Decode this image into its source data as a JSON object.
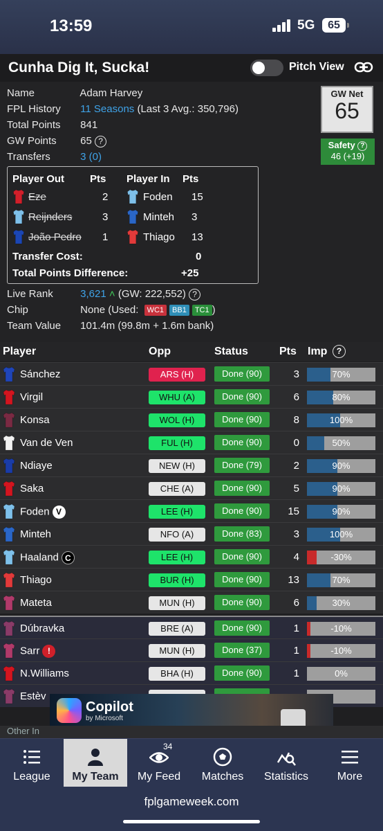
{
  "status_bar": {
    "time": "13:59",
    "network": "5G",
    "battery": "65"
  },
  "header": {
    "team_name": "Cunha Dig It, Sucka!",
    "pitch_view_label": "Pitch View"
  },
  "info": {
    "name_label": "Name",
    "name_value": "Adam Harvey",
    "history_label": "FPL History",
    "history_link": "11 Seasons",
    "history_rest": "(Last 3 Avg.: 350,796)",
    "total_label": "Total Points",
    "total_value": "841",
    "gw_label": "GW Points",
    "gw_value": "65",
    "transfers_label": "Transfers",
    "transfers_value": "3 (0)",
    "live_rank_label": "Live Rank",
    "live_rank_value": "3,621",
    "live_rank_gw": "(GW: 222,552)",
    "chip_label": "Chip",
    "chip_value": "None",
    "chip_used_prefix": "(Used:",
    "chip_used_suffix": ")",
    "chips": [
      {
        "label": "WC1",
        "color": "#c8323c"
      },
      {
        "label": "BB1",
        "color": "#2f8fb8"
      },
      {
        "label": "TC1",
        "color": "#2a8f3a"
      }
    ],
    "team_value_label": "Team Value",
    "team_value": "101.4m (99.8m + 1.6m bank)"
  },
  "gw_net": {
    "title": "GW Net",
    "value": "65"
  },
  "safety": {
    "title": "Safety",
    "value": "46 (+19)"
  },
  "transfers": {
    "headers": {
      "out": "Player Out",
      "pts": "Pts",
      "in": "Player In",
      "pts_in": "Pts"
    },
    "rows": [
      {
        "out": "Eze",
        "out_pts": "2",
        "in": "Foden",
        "in_pts": "15",
        "out_kit": "#d11f2a",
        "in_kit": "#7ec0ea"
      },
      {
        "out": "Reijnders",
        "out_pts": "3",
        "in": "Minteh",
        "in_pts": "3",
        "out_kit": "#7ec0ea",
        "in_kit": "#2a66c7"
      },
      {
        "out": "João Pedro",
        "out_pts": "1",
        "in": "Thiago",
        "in_pts": "13",
        "out_kit": "#1b46b4",
        "in_kit": "#e23a3a"
      }
    ],
    "cost_label": "Transfer Cost:",
    "cost_value": "0",
    "diff_label": "Total Points Difference:",
    "diff_value": "+25"
  },
  "table": {
    "headers": {
      "player": "Player",
      "opp": "Opp",
      "status": "Status",
      "pts": "Pts",
      "imp": "Imp"
    },
    "players": [
      {
        "name": "Sánchez",
        "badge": "",
        "kit": "#1f45b8",
        "opp": "ARS (H)",
        "opp_color": "#e0224e",
        "opp_text": "#ffffff",
        "status": "Done (90)",
        "pts": "3",
        "imp": "70%",
        "imp_pct": 0.34,
        "neg": false,
        "bench": false
      },
      {
        "name": "Virgil",
        "badge": "",
        "kit": "#d3151f",
        "opp": "WHU (A)",
        "opp_color": "#1ee36a",
        "opp_text": "#111111",
        "status": "Done (90)",
        "pts": "6",
        "imp": "80%",
        "imp_pct": 0.38,
        "neg": false,
        "bench": false
      },
      {
        "name": "Konsa",
        "badge": "",
        "kit": "#7a2a43",
        "opp": "WOL (H)",
        "opp_color": "#1ee36a",
        "opp_text": "#111111",
        "status": "Done (90)",
        "pts": "8",
        "imp": "100%",
        "imp_pct": 0.48,
        "neg": false,
        "bench": false
      },
      {
        "name": "Van de Ven",
        "badge": "",
        "kit": "#f2f2f2",
        "opp": "FUL (H)",
        "opp_color": "#1ee36a",
        "opp_text": "#111111",
        "status": "Done (90)",
        "pts": "0",
        "imp": "50%",
        "imp_pct": 0.25,
        "neg": false,
        "bench": false
      },
      {
        "name": "Ndiaye",
        "badge": "",
        "kit": "#1a3ca8",
        "opp": "NEW (H)",
        "opp_color": "#e6e6e6",
        "opp_text": "#111111",
        "status": "Done (79)",
        "pts": "2",
        "imp": "90%",
        "imp_pct": 0.44,
        "neg": false,
        "bench": false
      },
      {
        "name": "Saka",
        "badge": "",
        "kit": "#d3151f",
        "opp": "CHE (A)",
        "opp_color": "#e6e6e6",
        "opp_text": "#111111",
        "status": "Done (90)",
        "pts": "5",
        "imp": "90%",
        "imp_pct": 0.44,
        "neg": false,
        "bench": false
      },
      {
        "name": "Foden",
        "badge": "V",
        "badge_style": "white",
        "kit": "#7ec0ea",
        "opp": "LEE (H)",
        "opp_color": "#1ee36a",
        "opp_text": "#111111",
        "status": "Done (90)",
        "pts": "15",
        "imp": "90%",
        "imp_pct": 0.44,
        "neg": false,
        "bench": false
      },
      {
        "name": "Minteh",
        "badge": "",
        "kit": "#2a66c7",
        "opp": "NFO (A)",
        "opp_color": "#e6e6e6",
        "opp_text": "#111111",
        "status": "Done (83)",
        "pts": "3",
        "imp": "100%",
        "imp_pct": 0.48,
        "neg": false,
        "bench": false
      },
      {
        "name": "Haaland",
        "badge": "C",
        "badge_style": "dark",
        "kit": "#7ec0ea",
        "opp": "LEE (H)",
        "opp_color": "#1ee36a",
        "opp_text": "#111111",
        "status": "Done (90)",
        "pts": "4",
        "imp": "-30%",
        "imp_pct": 0.14,
        "neg": true,
        "bench": false
      },
      {
        "name": "Thiago",
        "badge": "",
        "kit": "#e23a3a",
        "opp": "BUR (H)",
        "opp_color": "#1ee36a",
        "opp_text": "#111111",
        "status": "Done (90)",
        "pts": "13",
        "imp": "70%",
        "imp_pct": 0.34,
        "neg": false,
        "bench": false
      },
      {
        "name": "Mateta",
        "badge": "",
        "kit": "#b03a6a",
        "opp": "MUN (H)",
        "opp_color": "#e6e6e6",
        "opp_text": "#111111",
        "status": "Done (90)",
        "pts": "6",
        "imp": "30%",
        "imp_pct": 0.14,
        "neg": false,
        "bench": false
      },
      {
        "name": "Dúbravka",
        "badge": "",
        "kit": "#8a3b68",
        "opp": "BRE (A)",
        "opp_color": "#e6e6e6",
        "opp_text": "#111111",
        "status": "Done (90)",
        "pts": "1",
        "imp": "-10%",
        "imp_pct": 0.05,
        "neg": true,
        "bench": true
      },
      {
        "name": "Sarr",
        "badge": "!",
        "badge_style": "red",
        "kit": "#b03a6a",
        "opp": "MUN (H)",
        "opp_color": "#e6e6e6",
        "opp_text": "#111111",
        "status": "Done (37)",
        "pts": "1",
        "imp": "-10%",
        "imp_pct": 0.05,
        "neg": true,
        "bench": true
      },
      {
        "name": "N.Williams",
        "badge": "",
        "kit": "#d3151f",
        "opp": "BHA (H)",
        "opp_color": "#e6e6e6",
        "opp_text": "#111111",
        "status": "Done (90)",
        "pts": "1",
        "imp": "0%",
        "imp_pct": 0.0,
        "neg": false,
        "bench": true
      },
      {
        "name": "Estèv",
        "badge": "",
        "kit": "#8a3b68",
        "opp": "",
        "opp_color": "#e6e6e6",
        "opp_text": "#111111",
        "status": "",
        "pts": "",
        "imp": "",
        "imp_pct": 0.0,
        "neg": false,
        "bench": true
      }
    ]
  },
  "ad": {
    "title": "Copilot",
    "subtitle": "by Microsoft"
  },
  "other_text": "Other In",
  "nav": {
    "items": [
      {
        "label": "League",
        "icon": "list-icon"
      },
      {
        "label": "My Team",
        "icon": "person-icon"
      },
      {
        "label": "My Feed",
        "icon": "eye-icon",
        "badge": "34"
      },
      {
        "label": "Matches",
        "icon": "football-icon"
      },
      {
        "label": "Statistics",
        "icon": "chart-search-icon"
      },
      {
        "label": "More",
        "icon": "menu-icon"
      }
    ]
  },
  "url": "fplgameweek.com"
}
